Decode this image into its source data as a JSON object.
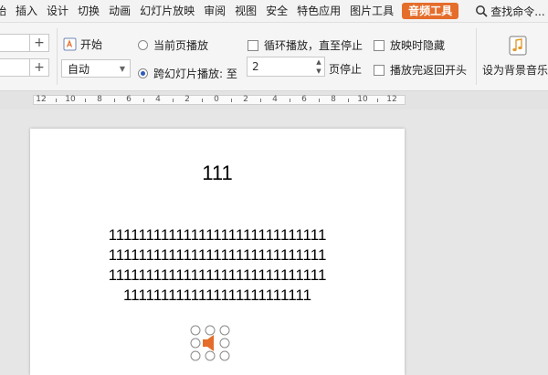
{
  "menubar": {
    "items": [
      "始",
      "插入",
      "设计",
      "切换",
      "动画",
      "幻灯片放映",
      "审阅",
      "视图",
      "安全",
      "特色应用",
      "图片工具"
    ],
    "active_tab": "音频工具",
    "search_label": "查找命令..."
  },
  "ribbon": {
    "volume_plus_1": "+",
    "volume_plus_2": "+",
    "start_label": "开始",
    "start_mode": "自动",
    "play_current_page": "当前页播放",
    "play_across_slides": "跨幻灯片播放: 至",
    "stop_page_value": "2",
    "stop_page_suffix": "页停止",
    "loop_label": "循环播放，直至停止",
    "hide_label": "放映时隐藏",
    "rewind_label": "播放完返回开头",
    "set_bg_music": "设为背景音乐"
  },
  "ruler": {
    "labels": [
      "12",
      "10",
      "8",
      "6",
      "4",
      "2",
      "0",
      "2",
      "4",
      "6",
      "8",
      "10",
      "12"
    ]
  },
  "slide": {
    "title": "111",
    "body_lines": [
      "11111111111111111111111111111",
      "11111111111111111111111111111",
      "11111111111111111111111111111",
      "1111111111111111111111111"
    ]
  },
  "colors": {
    "accent": "#e56d2b",
    "radio_selected": "#2c5bb8",
    "audio_icon": "#e56d2b"
  }
}
